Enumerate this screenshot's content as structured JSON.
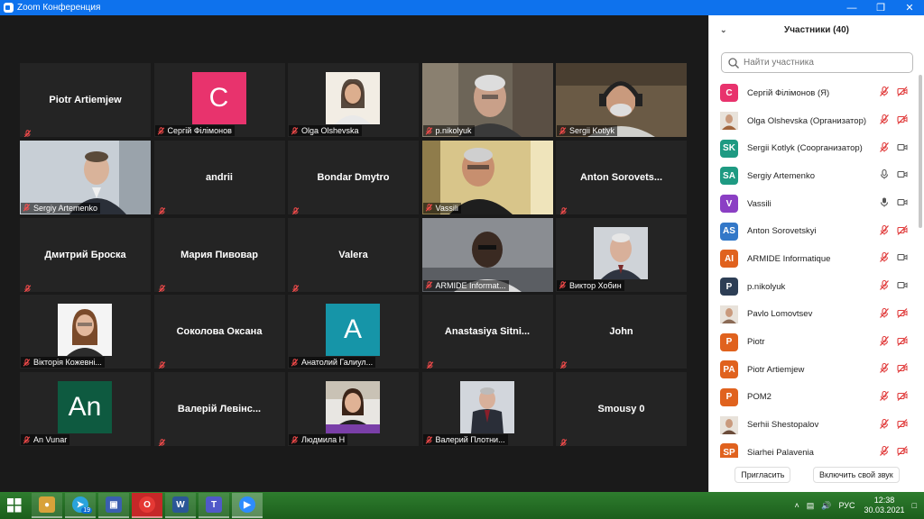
{
  "window": {
    "title": "Zoom Конференция",
    "accent": "#0e72ed"
  },
  "grid": {
    "tiles": [
      {
        "row": 0,
        "col": 0,
        "kind": "name",
        "name": "Piotr Artiemjew"
      },
      {
        "row": 0,
        "col": 1,
        "kind": "avatar",
        "letter": "С",
        "bg": "#e8336d",
        "label": "Сергій Філімонов"
      },
      {
        "row": 0,
        "col": 2,
        "kind": "photo",
        "photo": "woman",
        "label": "Olga Olshevska"
      },
      {
        "row": 0,
        "col": 3,
        "kind": "video",
        "scene": "man-glasses-indoor",
        "label": "p.nikolyuk"
      },
      {
        "row": 0,
        "col": 4,
        "kind": "video",
        "scene": "man-headphones",
        "label": "Sergii Kotlyk"
      },
      {
        "row": 1,
        "col": 0,
        "kind": "video",
        "scene": "man-suit",
        "label": "Sergiy Artemenko"
      },
      {
        "row": 1,
        "col": 1,
        "kind": "name",
        "name": "andrii"
      },
      {
        "row": 1,
        "col": 2,
        "kind": "name",
        "name": "Bondar Dmytro"
      },
      {
        "row": 1,
        "col": 3,
        "kind": "video",
        "scene": "man-speaking",
        "label": "Vassili",
        "active": true
      },
      {
        "row": 1,
        "col": 4,
        "kind": "name",
        "name": "Anton  Sorovets..."
      },
      {
        "row": 2,
        "col": 0,
        "kind": "name",
        "name": "Дмитрий Броска"
      },
      {
        "row": 2,
        "col": 1,
        "kind": "name",
        "name": "Мария Пивовар"
      },
      {
        "row": 2,
        "col": 2,
        "kind": "name",
        "name": "Valera"
      },
      {
        "row": 2,
        "col": 3,
        "kind": "video",
        "scene": "man-dark",
        "label": "ARMIDE Informat..."
      },
      {
        "row": 2,
        "col": 4,
        "kind": "photo",
        "photo": "older-man",
        "label": "Виктор Хобин"
      },
      {
        "row": 3,
        "col": 0,
        "kind": "photo",
        "photo": "young-woman",
        "label": "Вікторія Кожевні..."
      },
      {
        "row": 3,
        "col": 1,
        "kind": "name",
        "name": "Соколова Оксана"
      },
      {
        "row": 3,
        "col": 2,
        "kind": "avatar",
        "letter": "A",
        "bg": "#1695a8",
        "label": "Анатолий Галиул..."
      },
      {
        "row": 3,
        "col": 3,
        "kind": "name",
        "name": "Anastasiya  Sitni..."
      },
      {
        "row": 3,
        "col": 4,
        "kind": "name",
        "name": "John"
      },
      {
        "row": 4,
        "col": 0,
        "kind": "avatar",
        "letter": "An",
        "bg": "#0e5a40",
        "label": "An Vunar"
      },
      {
        "row": 4,
        "col": 1,
        "kind": "name",
        "name": "Валерій Левінс..."
      },
      {
        "row": 4,
        "col": 2,
        "kind": "photo",
        "photo": "woman-desk",
        "label": "Людмила Н"
      },
      {
        "row": 4,
        "col": 3,
        "kind": "photo",
        "photo": "man-suit-2",
        "label": "Валерий Плотни..."
      },
      {
        "row": 4,
        "col": 4,
        "kind": "name",
        "name": "Smousy 0"
      }
    ]
  },
  "sidebar": {
    "title": "Участники (40)",
    "search_placeholder": "Найти участника",
    "participants": [
      {
        "initials": "С",
        "bg": "#e8336d",
        "name": "Сергій Філімонов (Я)",
        "mic": "muted",
        "cam": "off"
      },
      {
        "initials": "",
        "photo": true,
        "bg": "#a0643c",
        "name": "Olga Olshevska (Организатор)",
        "mic": "muted",
        "cam": "off"
      },
      {
        "initials": "SK",
        "bg": "#1e9a82",
        "name": "Sergii Kotlyk (Соорганизатор)",
        "mic": "muted",
        "cam": "on"
      },
      {
        "initials": "SA",
        "bg": "#1e9a82",
        "name": "Sergiy Artemenko",
        "mic": "on",
        "cam": "on"
      },
      {
        "initials": "V",
        "bg": "#8b3fc4",
        "name": "Vassili",
        "mic": "active",
        "cam": "on"
      },
      {
        "initials": "AS",
        "bg": "#3378c8",
        "name": "Anton Sorovetskyi",
        "mic": "muted",
        "cam": "off"
      },
      {
        "initials": "AI",
        "bg": "#e0621e",
        "name": "ARMIDE Informatique",
        "mic": "muted",
        "cam": "on"
      },
      {
        "initials": "P",
        "bg": "#2d3e55",
        "name": "p.nikolyuk",
        "mic": "muted",
        "cam": "on"
      },
      {
        "initials": "",
        "photo": true,
        "bg": "#8a6a55",
        "name": "Pavlo Lomovtsev",
        "mic": "muted",
        "cam": "off"
      },
      {
        "initials": "P",
        "bg": "#e0621e",
        "name": "Piotr",
        "mic": "muted",
        "cam": "off"
      },
      {
        "initials": "PA",
        "bg": "#e0621e",
        "name": "Piotr Artiemjew",
        "mic": "muted",
        "cam": "off"
      },
      {
        "initials": "P",
        "bg": "#e0621e",
        "name": "POM2",
        "mic": "muted",
        "cam": "off"
      },
      {
        "initials": "",
        "photo": true,
        "bg": "#6b4c3a",
        "name": "Serhii Shestopalov",
        "mic": "muted",
        "cam": "off"
      },
      {
        "initials": "SP",
        "bg": "#e0621e",
        "name": "Siarhei Palavenia",
        "mic": "muted",
        "cam": "off"
      }
    ],
    "invite_label": "Пригласить",
    "audio_label": "Включить свой звук"
  },
  "taskbar": {
    "telegram_badge": "19",
    "language": "РУС",
    "time": "12:38",
    "date": "30.03.2021"
  }
}
